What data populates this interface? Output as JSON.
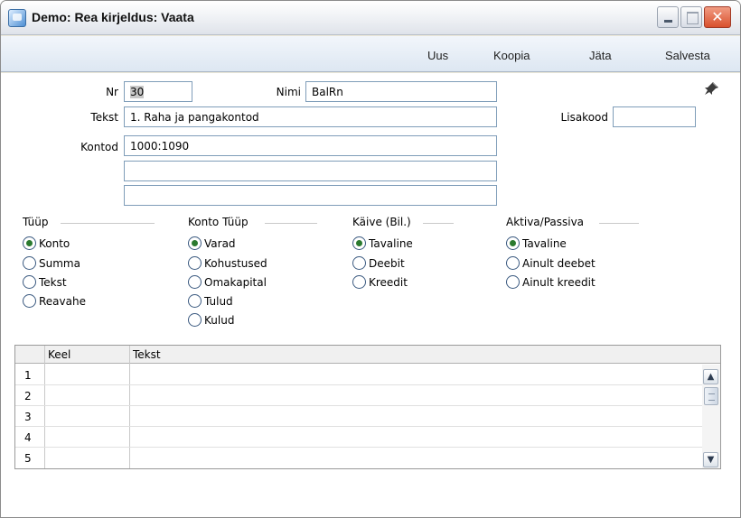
{
  "window": {
    "title": "Demo: Rea kirjeldus: Vaata",
    "close_glyph": "✕"
  },
  "toolbar": {
    "buttons": [
      "Uus",
      "Koopia",
      "Jäta",
      "Salvesta"
    ]
  },
  "form": {
    "nr_label": "Nr",
    "nr_value": "30",
    "nimi_label": "Nimi",
    "nimi_value": "BalRn",
    "tekst_label": "Tekst",
    "tekst_value": "1. Raha ja pangakontod",
    "lisakood_label": "Lisakood",
    "lisakood_value": "",
    "kontod_label": "Kontod",
    "kontod_values": [
      "1000:1090",
      "",
      ""
    ]
  },
  "groups": [
    {
      "title": "Tüüp",
      "options": [
        "Konto",
        "Summa",
        "Tekst",
        "Reavahe"
      ],
      "selected": 0
    },
    {
      "title": "Konto Tüüp",
      "options": [
        "Varad",
        "Kohustused",
        "Omakapital",
        "Tulud",
        "Kulud"
      ],
      "selected": 0
    },
    {
      "title": "Käive (Bil.)",
      "options": [
        "Tavaline",
        "Deebit",
        "Kreedit"
      ],
      "selected": 0
    },
    {
      "title": "Aktiva/Passiva",
      "options": [
        "Tavaline",
        "Ainult deebet",
        "Ainult kreedit"
      ],
      "selected": 0
    }
  ],
  "grid": {
    "columns": [
      "Keel",
      "Tekst"
    ],
    "rows": [
      {
        "num": "1",
        "keel": "",
        "tekst": ""
      },
      {
        "num": "2",
        "keel": "",
        "tekst": ""
      },
      {
        "num": "3",
        "keel": "",
        "tekst": ""
      },
      {
        "num": "4",
        "keel": "",
        "tekst": ""
      },
      {
        "num": "5",
        "keel": "",
        "tekst": ""
      }
    ],
    "scroll_up_glyph": "▲",
    "scroll_down_glyph": "▼"
  },
  "icons": {
    "app": "app-window-icon",
    "pin": "pin-icon",
    "minimize": "minimize-icon",
    "maximize": "maximize-icon",
    "close": "close-icon"
  },
  "colors": {
    "radio_selected": "#2b7a2f",
    "close_button": "#d9502d",
    "field_border": "#7f9db9"
  }
}
